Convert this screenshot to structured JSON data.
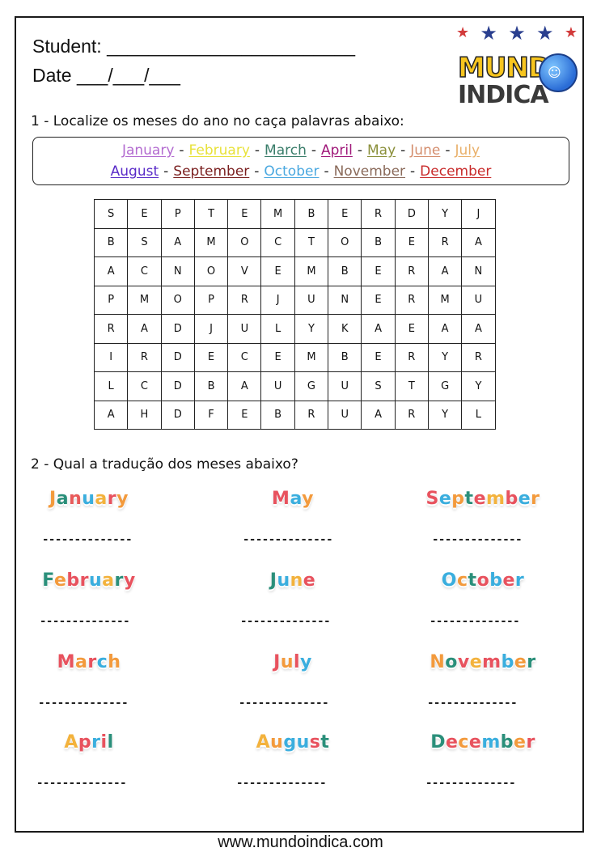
{
  "header": {
    "student_label": "Student: ________________________",
    "date_label": "Date ___/___/___"
  },
  "logo": {
    "line1": "MUNDO",
    "line2": "INDICA",
    "stars": [
      "★",
      "★",
      "★",
      "★",
      "★"
    ]
  },
  "question1": {
    "title": "1 - Localize os meses do ano no caça palavras abaixo:",
    "word_bank_row1": [
      {
        "text": "January",
        "color": "#b36bd0"
      },
      {
        "text": "February",
        "color": "#e8e23a"
      },
      {
        "text": "March",
        "color": "#3a7d6a"
      },
      {
        "text": "April",
        "color": "#a0197a"
      },
      {
        "text": "May",
        "color": "#8a8f3a"
      },
      {
        "text": "June",
        "color": "#d48e6e"
      },
      {
        "text": "July",
        "color": "#e9b06a"
      }
    ],
    "word_bank_row2": [
      {
        "text": "August",
        "color": "#5a2bc8"
      },
      {
        "text": "September",
        "color": "#7a1f1f"
      },
      {
        "text": "October",
        "color": "#4aa8e0"
      },
      {
        "text": "November",
        "color": "#8a6a5a"
      },
      {
        "text": "December",
        "color": "#c82a2a"
      }
    ],
    "separator": "-",
    "grid": [
      [
        "S",
        "E",
        "P",
        "T",
        "E",
        "M",
        "B",
        "E",
        "R",
        "D",
        "Y",
        "J"
      ],
      [
        "B",
        "S",
        "A",
        "M",
        "O",
        "C",
        "T",
        "O",
        "B",
        "E",
        "R",
        "A"
      ],
      [
        "A",
        "C",
        "N",
        "O",
        "V",
        "E",
        "M",
        "B",
        "E",
        "R",
        "A",
        "N"
      ],
      [
        "P",
        "M",
        "O",
        "P",
        "R",
        "J",
        "U",
        "N",
        "E",
        "R",
        "M",
        "U"
      ],
      [
        "R",
        "A",
        "D",
        "J",
        "U",
        "L",
        "Y",
        "K",
        "A",
        "E",
        "A",
        "A"
      ],
      [
        "I",
        "R",
        "D",
        "E",
        "C",
        "E",
        "M",
        "B",
        "E",
        "R",
        "Y",
        "R"
      ],
      [
        "L",
        "C",
        "D",
        "B",
        "A",
        "U",
        "G",
        "U",
        "S",
        "T",
        "G",
        "Y"
      ],
      [
        "A",
        "H",
        "D",
        "F",
        "E",
        "B",
        "R",
        "U",
        "A",
        "R",
        "Y",
        "L"
      ]
    ]
  },
  "question2": {
    "title": "2 - Qual a tradução dos meses abaixo?",
    "answer_placeholder": "--------------",
    "months": [
      {
        "name": "January",
        "colors": [
          "#f39a3c",
          "#2a8f7a",
          "#e85a5a",
          "#3aaede",
          "#f3b23c",
          "#e8525e",
          "#f39a3c"
        ]
      },
      {
        "name": "May",
        "colors": [
          "#e8525e",
          "#3aaede",
          "#f39a3c"
        ]
      },
      {
        "name": "September",
        "colors": [
          "#e8525e",
          "#3aaede",
          "#f39a3c",
          "#2a8f7a",
          "#e8525e",
          "#f3b23c",
          "#e8525e",
          "#3aaede",
          "#f39a3c"
        ]
      },
      {
        "name": "February",
        "colors": [
          "#2a8f7a",
          "#f39a3c",
          "#e8525e",
          "#e8525e",
          "#3aaede",
          "#f3b23c",
          "#2a8f7a",
          "#e8525e"
        ]
      },
      {
        "name": "June",
        "colors": [
          "#2a8f7a",
          "#3aaede",
          "#f3b23c",
          "#e8525e"
        ]
      },
      {
        "name": "October",
        "colors": [
          "#3aaede",
          "#f39a3c",
          "#2a8f7a",
          "#e8525e",
          "#3aaede",
          "#e8525e",
          "#3aaede"
        ]
      },
      {
        "name": "March",
        "colors": [
          "#e8525e",
          "#f39a3c",
          "#e8525e",
          "#3aaede",
          "#f39a3c"
        ]
      },
      {
        "name": "July",
        "colors": [
          "#e8525e",
          "#f39a3c",
          "#e8525e",
          "#3aaede"
        ]
      },
      {
        "name": "November",
        "colors": [
          "#f39a3c",
          "#2a8f7a",
          "#e8525e",
          "#f3b23c",
          "#e8525e",
          "#3aaede",
          "#f39a3c",
          "#2a8f7a"
        ]
      },
      {
        "name": "April",
        "colors": [
          "#f3b23c",
          "#e8525e",
          "#3aaede",
          "#e8525e",
          "#2a8f7a"
        ]
      },
      {
        "name": "August",
        "colors": [
          "#f3b23c",
          "#f39a3c",
          "#3aaede",
          "#3aaede",
          "#e8525e",
          "#2a8f7a"
        ]
      },
      {
        "name": "December",
        "colors": [
          "#2a8f7a",
          "#e8525e",
          "#f39a3c",
          "#e8525e",
          "#3aaede",
          "#2a8f7a",
          "#f39a3c",
          "#e8525e"
        ]
      }
    ]
  },
  "footer": {
    "url": "www.mundoindica.com"
  }
}
